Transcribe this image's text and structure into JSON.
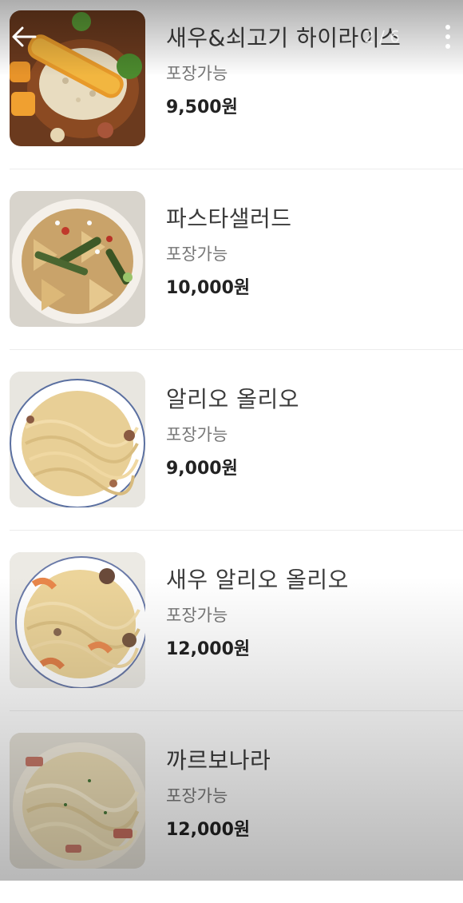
{
  "header": {
    "counter": "2 / 6",
    "back_icon": "arrow-left-icon",
    "more_icon": "more-vertical-icon"
  },
  "menu": {
    "items": [
      {
        "name": "새우&쇠고기 하이라이스",
        "tag": "포장가능",
        "price": "9,500원"
      },
      {
        "name": "파스타샐러드",
        "tag": "포장가능",
        "price": "10,000원"
      },
      {
        "name": "알리오 올리오",
        "tag": "포장가능",
        "price": "9,000원"
      },
      {
        "name": "새우 알리오 올리오",
        "tag": "포장가능",
        "price": "12,000원"
      },
      {
        "name": "까르보나라",
        "tag": "포장가능",
        "price": "12,000원"
      }
    ]
  }
}
